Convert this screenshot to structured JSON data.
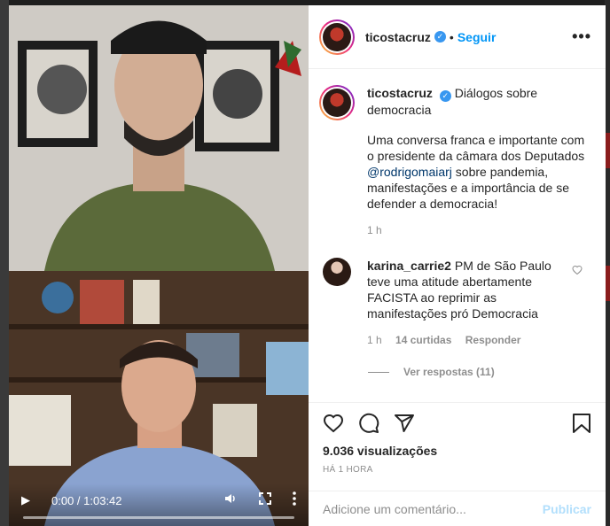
{
  "post": {
    "username": "ticostacruz",
    "follow_label": "Seguir",
    "separator": "•",
    "more_label": "•••"
  },
  "caption": {
    "username": "ticostacruz",
    "title": "Diálogos sobre democracia",
    "text_before_mention": "Uma conversa franca e importante com o presidente da câmara dos Deputados ",
    "mention": "@rodrigomaiarj",
    "text_after_mention": " sobre pandemia, manifestações e a importância de se defender a democracia!",
    "time": "1 h"
  },
  "comment": {
    "username": "karina_carrie2",
    "text": "PM de São Paulo teve uma atitude abertamente FACISTA ao reprimir as manifestações pró Democracia",
    "time": "1 h",
    "likes": "14 curtidas",
    "reply_label": "Responder",
    "view_replies": "Ver respostas (11)"
  },
  "video": {
    "time_display": "0:00 / 1:03:42",
    "progress": 0
  },
  "stats": {
    "views": "9.036 visualizações",
    "time_ago": "HÁ 1 HORA"
  },
  "composer": {
    "placeholder": "Adicione um comentário...",
    "publish_label": "Publicar"
  },
  "colors": {
    "link": "#0095f6",
    "verified": "#3897f0",
    "muted": "#8e8e8e"
  },
  "icons": [
    "heart-icon",
    "comment-icon",
    "share-icon",
    "bookmark-icon",
    "play-icon",
    "volume-icon",
    "fullscreen-icon",
    "more-vertical-icon",
    "verified-icon"
  ]
}
